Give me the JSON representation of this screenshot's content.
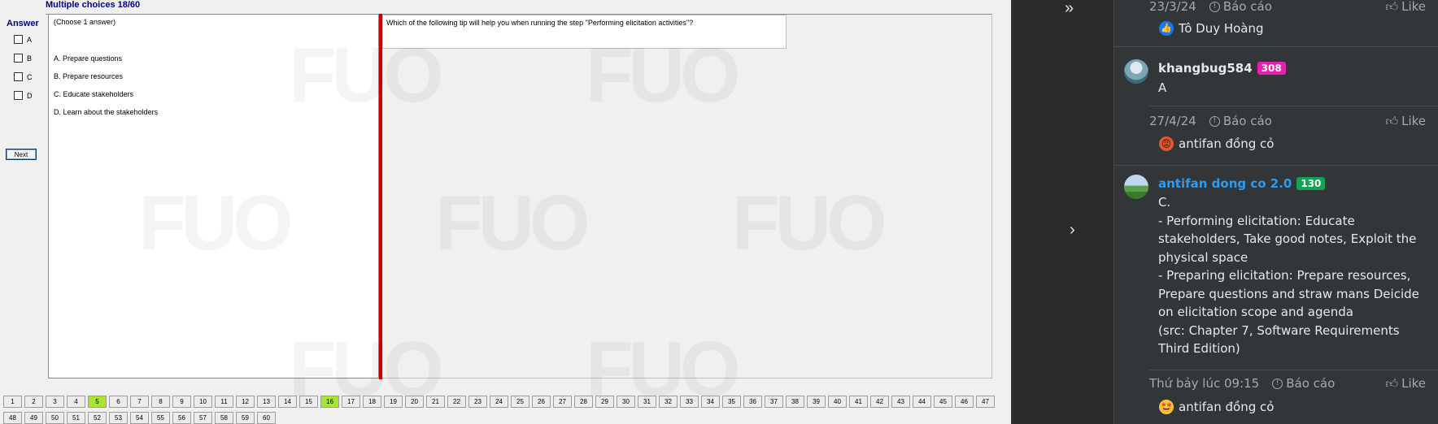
{
  "exam": {
    "title": "Multiple choices 18/60",
    "answer_label": "Answer",
    "options": [
      "A",
      "B",
      "C",
      "D"
    ],
    "next_label": "Next",
    "choose_hint": "(Choose 1 answer)",
    "choices": [
      "A.  Prepare questions",
      "B.  Prepare resources",
      "C.  Educate stakeholders",
      "D.  Learn about the stakeholders"
    ],
    "question": "Which of the following tip will help you when running the step \"Performing elicitation activities\"?",
    "nav_row1": [
      "1",
      "2",
      "3",
      "4",
      "5",
      "6",
      "7",
      "8",
      "9",
      "10",
      "11",
      "12",
      "13",
      "14",
      "15",
      "16",
      "17",
      "18",
      "19",
      "20",
      "21",
      "22",
      "23",
      "24",
      "25",
      "26",
      "27",
      "28",
      "29",
      "30",
      "31",
      "32",
      "33",
      "34",
      "35",
      "36",
      "37",
      "38",
      "39",
      "40",
      "41",
      "42",
      "43",
      "44",
      "45",
      "46",
      "47"
    ],
    "nav_row2": [
      "48",
      "49",
      "50",
      "51",
      "52",
      "53",
      "54",
      "55",
      "56",
      "57",
      "58",
      "59",
      "60"
    ],
    "answered": [
      "5",
      "16"
    ],
    "colors": {
      "title": "#00008b",
      "answered": "#a6e62e",
      "divider": "#d10000"
    }
  },
  "nav_arrows": {
    "collapse": "»",
    "next": "›"
  },
  "comments": {
    "top_meta": {
      "date": "23/3/24",
      "report": "Báo cáo",
      "like": "Like"
    },
    "top_reaction": {
      "name": "Tô Duy Hoàng",
      "icon": "thumbs-up-icon"
    },
    "c1": {
      "user": "khangbug584",
      "score": "308",
      "body": "A",
      "date": "27/4/24",
      "report": "Báo cáo",
      "like": "Like",
      "reaction": {
        "name": "antifan đồng cỏ",
        "icon": "angry-face-icon"
      }
    },
    "c2": {
      "user": "antifan dong co 2.0",
      "score": "130",
      "body": [
        "C.",
        "- Performing elicitation: Educate stakeholders, Take good notes, Exploit the physical space",
        "- Preparing elicitation: Prepare resources, Prepare questions and straw mans Deicide on elicitation scope and agenda",
        "(src: Chapter 7, Software Requirements Third Edition)"
      ],
      "date": "Thứ bảy lúc 09:15",
      "report": "Báo cáo",
      "like": "Like",
      "reaction": {
        "name": "antifan đồng cỏ",
        "icon": "star-struck-icon"
      }
    },
    "colors": {
      "badge_pink": "#e81fb2",
      "badge_green": "#12a452",
      "username_blue": "#2d9cf0"
    }
  }
}
